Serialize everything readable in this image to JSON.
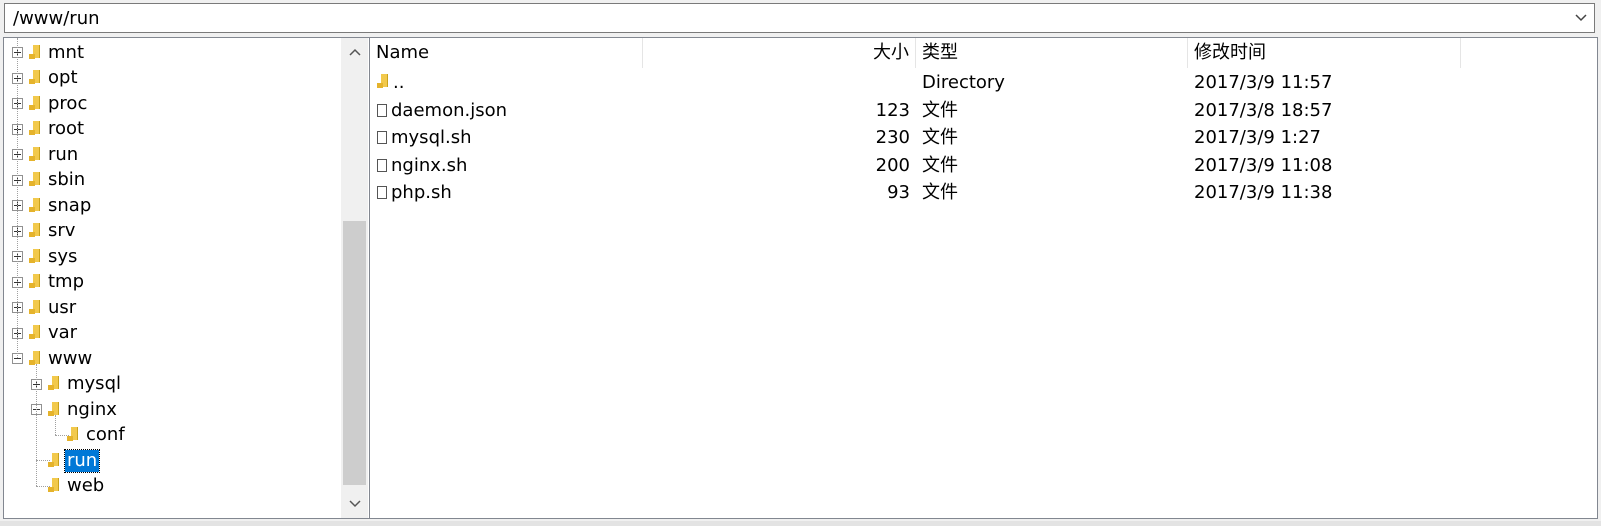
{
  "path_bar": {
    "value": "/www/run"
  },
  "tree": {
    "items": [
      {
        "label": "mnt",
        "depth": 0,
        "toggle": "plus",
        "selected": false
      },
      {
        "label": "opt",
        "depth": 0,
        "toggle": "plus",
        "selected": false
      },
      {
        "label": "proc",
        "depth": 0,
        "toggle": "plus",
        "selected": false
      },
      {
        "label": "root",
        "depth": 0,
        "toggle": "plus",
        "selected": false
      },
      {
        "label": "run",
        "depth": 0,
        "toggle": "plus",
        "selected": false
      },
      {
        "label": "sbin",
        "depth": 0,
        "toggle": "plus",
        "selected": false
      },
      {
        "label": "snap",
        "depth": 0,
        "toggle": "plus",
        "selected": false
      },
      {
        "label": "srv",
        "depth": 0,
        "toggle": "plus",
        "selected": false
      },
      {
        "label": "sys",
        "depth": 0,
        "toggle": "plus",
        "selected": false
      },
      {
        "label": "tmp",
        "depth": 0,
        "toggle": "plus",
        "selected": false
      },
      {
        "label": "usr",
        "depth": 0,
        "toggle": "plus",
        "selected": false
      },
      {
        "label": "var",
        "depth": 0,
        "toggle": "plus",
        "selected": false
      },
      {
        "label": "www",
        "depth": 0,
        "toggle": "minus",
        "selected": false
      },
      {
        "label": "mysql",
        "depth": 1,
        "toggle": "plus",
        "selected": false
      },
      {
        "label": "nginx",
        "depth": 1,
        "toggle": "minus",
        "selected": false
      },
      {
        "label": "conf",
        "depth": 2,
        "toggle": "none",
        "selected": false
      },
      {
        "label": "run",
        "depth": 1,
        "toggle": "none",
        "selected": true
      },
      {
        "label": "web",
        "depth": 1,
        "toggle": "none",
        "selected": false
      }
    ]
  },
  "list": {
    "columns": [
      {
        "label": "Name",
        "align": "left"
      },
      {
        "label": "大小",
        "align": "right"
      },
      {
        "label": "类型",
        "align": "left"
      },
      {
        "label": "修改时间",
        "align": "left"
      },
      {
        "label": "",
        "align": "left"
      }
    ],
    "rows": [
      {
        "icon": "folder-icon",
        "name": "..",
        "size": "",
        "type": "Directory",
        "modified": "2017/3/9 11:57"
      },
      {
        "icon": "file-icon",
        "name": "daemon.json",
        "size": "123",
        "type": "文件",
        "modified": "2017/3/8 18:57"
      },
      {
        "icon": "file-icon",
        "name": "mysql.sh",
        "size": "230",
        "type": "文件",
        "modified": "2017/3/9 1:27"
      },
      {
        "icon": "file-icon",
        "name": "nginx.sh",
        "size": "200",
        "type": "文件",
        "modified": "2017/3/9 11:08"
      },
      {
        "icon": "file-icon",
        "name": "php.sh",
        "size": "93",
        "type": "文件",
        "modified": "2017/3/9 11:38"
      }
    ]
  },
  "colors": {
    "selection": "#0078d7",
    "folder": "#f2c94c"
  }
}
